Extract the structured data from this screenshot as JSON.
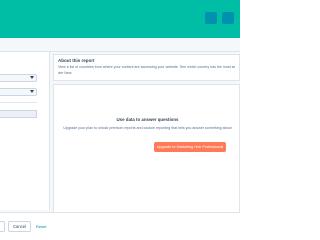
{
  "about": {
    "title": "About this report",
    "description_line1": "View a list of countries from where your content are accessing your website. See which country has the most sessions and",
    "description_line2": "are New."
  },
  "empty_state": {
    "title": "Use data to answer questions",
    "text": "Upgrade your plan to unlock premium reports and custom reporting that tells you answer something about",
    "upgrade_label": "Upgrade to Marketing Hub Professional"
  },
  "footer": {
    "cancel_label": "Cancel",
    "reset_label": "Reset"
  },
  "colors": {
    "topbar": "#00bda5",
    "accent_button": "#ff7a59",
    "link": "#0091ae"
  }
}
